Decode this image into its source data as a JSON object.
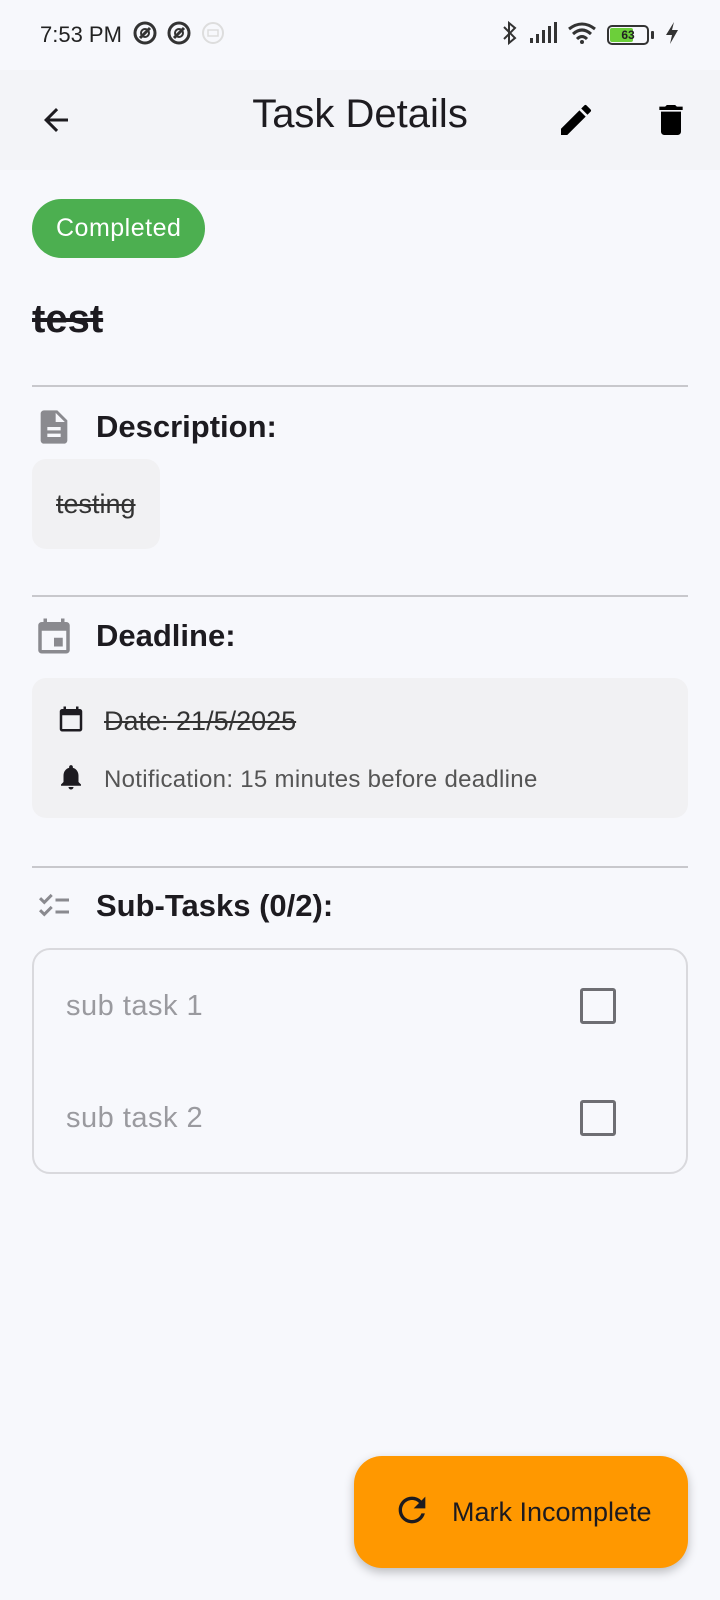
{
  "status_bar": {
    "time": "7:53 PM",
    "battery_level": "63",
    "icons": [
      "notification-icon",
      "notification-icon",
      "app-icon",
      "bluetooth-icon",
      "signal-icon",
      "wifi-icon",
      "battery-icon",
      "charging-icon"
    ]
  },
  "app_bar": {
    "title": "Task Details",
    "back_icon": "arrow-back-icon",
    "edit_icon": "pencil-icon",
    "delete_icon": "trash-icon"
  },
  "task": {
    "status": "Completed",
    "status_color": "#4caf50",
    "title": "test",
    "description_label": "Description:",
    "description": "testing",
    "deadline_label": "Deadline:",
    "deadline_date": "Date: 21/5/2025",
    "notification": "Notification: 15 minutes before deadline",
    "subtasks_label": "Sub-Tasks (0/2):",
    "subtasks": [
      {
        "label": "sub task 1",
        "checked": false
      },
      {
        "label": "sub task 2",
        "checked": false
      }
    ]
  },
  "fab": {
    "label": "Mark Incomplete",
    "icon": "refresh-icon",
    "color": "#ff9800"
  }
}
